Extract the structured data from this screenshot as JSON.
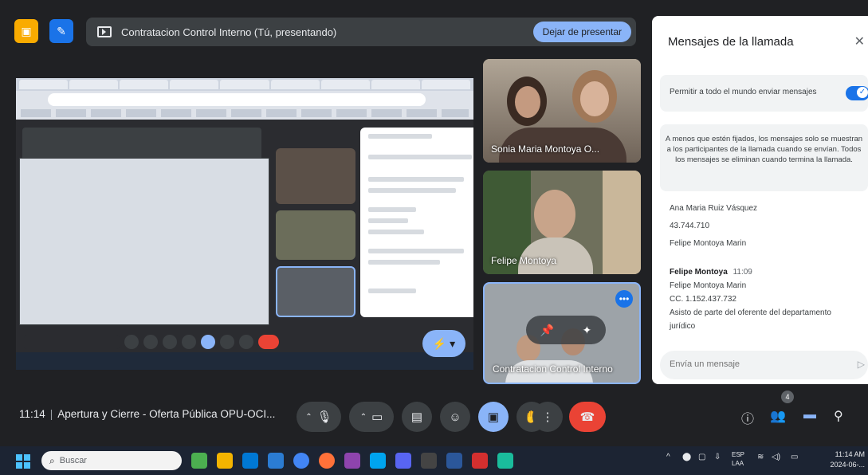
{
  "presentation": {
    "title": "Contratacion Control Interno (Tú, presentando)",
    "stop_label": "Dejar de presentar"
  },
  "participants": [
    {
      "name": "Sonia Maria Montoya O..."
    },
    {
      "name": "Felipe Montoya"
    },
    {
      "name": "Contratacion Control Interno"
    }
  ],
  "chat": {
    "title": "Mensajes de la llamada",
    "allow_label": "Permitir a todo el mundo enviar mensajes",
    "notice": "A menos que estén fijados, los mensajes solo se muestran a los participantes de la llamada cuando se envían. Todos los mensajes se eliminan cuando termina la llamada.",
    "message1": {
      "lines": [
        "Ana Maria Ruiz Vásquez",
        "43.744.710",
        "Felipe Montoya Marin"
      ]
    },
    "message2": {
      "sender": "Felipe Montoya",
      "time": "11:09",
      "lines": [
        "Felipe Montoya Marin",
        "CC. 1.152.437.732",
        "Asisto de parte del oferente del departamento",
        "jurídico"
      ]
    },
    "input_placeholder": "Envía un mensaje"
  },
  "meeting": {
    "time": "11:14",
    "name": "Apertura y Cierre - Oferta Pública OPU-OCI...",
    "people_count": "4"
  },
  "taskbar": {
    "search_placeholder": "Buscar",
    "lang": "ESP",
    "lang2": "LAA",
    "time": "11:14 AM",
    "date": "2024-06-..."
  },
  "colors": {
    "meet_bg": "#202124",
    "accent_blue": "#8ab4f8",
    "hangup_red": "#ea4335",
    "toggle_blue": "#1a73e8"
  }
}
